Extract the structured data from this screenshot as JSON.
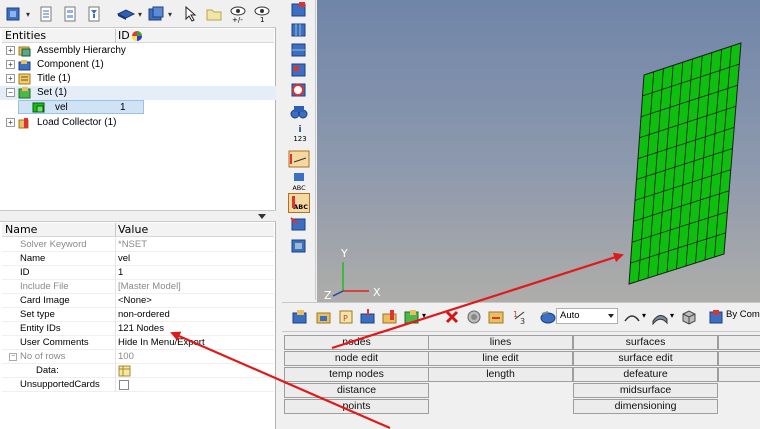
{
  "entity_browser": {
    "col_entities": "Entities",
    "col_id": "ID",
    "tree": [
      {
        "label": "Assembly Hierarchy"
      },
      {
        "label": "Component (1)"
      },
      {
        "label": "Title (1)"
      },
      {
        "label": "Set (1)"
      },
      {
        "label": "vel",
        "id": "1"
      },
      {
        "label": "Load Collector (1)"
      }
    ]
  },
  "properties": {
    "col_name": "Name",
    "col_value": "Value",
    "rows": [
      {
        "name": "Solver Keyword",
        "value": "*NSET"
      },
      {
        "name": "Name",
        "value": "vel"
      },
      {
        "name": "ID",
        "value": "1"
      },
      {
        "name": "Include File",
        "value": "[Master Model]"
      },
      {
        "name": "Card Image",
        "value": "<None>"
      },
      {
        "name": "Set type",
        "value": "non-ordered"
      },
      {
        "name": "Entity IDs",
        "value": "121 Nodes"
      },
      {
        "name": "User Comments",
        "value": "Hide In Menu/Export"
      },
      {
        "name": "No of rows",
        "value": "100"
      },
      {
        "name": "Data:",
        "value": ""
      },
      {
        "name": "UnsupportedCards",
        "value": ""
      }
    ]
  },
  "toolbar": {
    "auto_select": "Auto",
    "by_comp": "By Comp"
  },
  "axes": {
    "y": "Y",
    "x": "X",
    "z": "Z"
  },
  "vertical_toolbar": {
    "label_123": "123",
    "label_abc": "ABC",
    "label_abc2": "ABC"
  },
  "panel_buttons": [
    [
      "nodes",
      "lines",
      "surfaces"
    ],
    [
      "node edit",
      "line edit",
      "surface edit"
    ],
    [
      "temp nodes",
      "length",
      "defeature"
    ],
    [
      "distance",
      "",
      "midsurface"
    ],
    [
      "points",
      "",
      "dimensioning"
    ]
  ],
  "colors": {
    "mesh_fill": "#0fbf0f",
    "mesh_line": "#1a1a1a",
    "arrow": "#e0191b",
    "selection": "#cfe3f5"
  }
}
